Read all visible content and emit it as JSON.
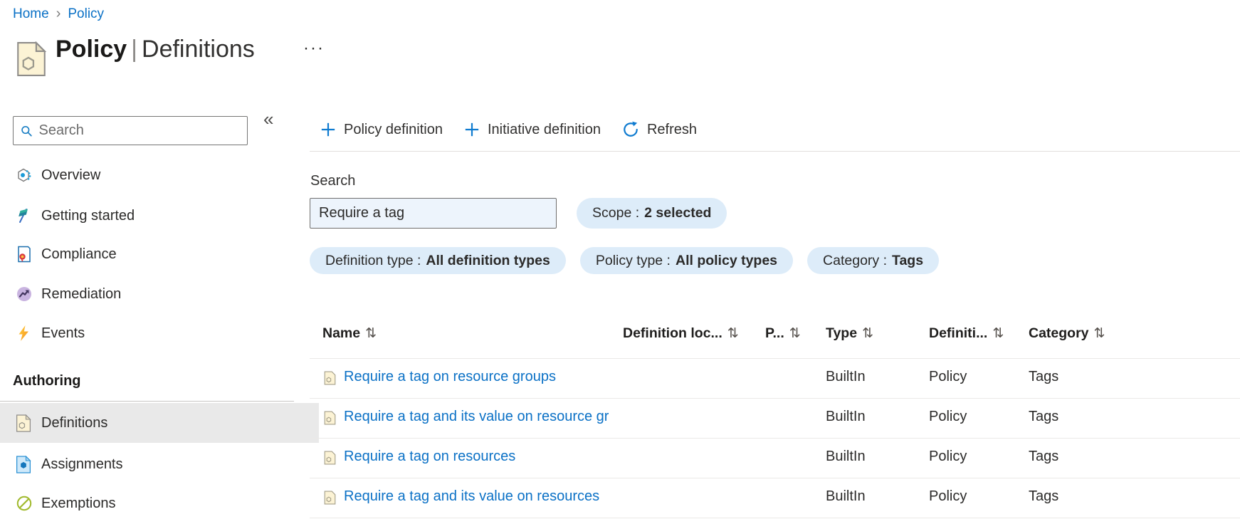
{
  "breadcrumb": {
    "separator": "›",
    "items": [
      {
        "label": "Home"
      },
      {
        "label": "Policy"
      }
    ]
  },
  "header": {
    "title_primary": "Policy",
    "title_separator": "|",
    "title_secondary": "Definitions",
    "more_glyph": "···"
  },
  "sidebar": {
    "search_placeholder": "Search",
    "collapse_glyph": "«",
    "items": [
      {
        "label": "Overview",
        "icon": "overview-icon"
      },
      {
        "label": "Getting started",
        "icon": "getting-started-icon"
      },
      {
        "label": "Compliance",
        "icon": "compliance-icon"
      },
      {
        "label": "Remediation",
        "icon": "remediation-icon"
      },
      {
        "label": "Events",
        "icon": "events-icon"
      }
    ],
    "section_label": "Authoring",
    "section_items": [
      {
        "label": "Definitions",
        "icon": "definitions-icon",
        "selected": true
      },
      {
        "label": "Assignments",
        "icon": "assignments-icon",
        "selected": false
      },
      {
        "label": "Exemptions",
        "icon": "exemptions-icon",
        "selected": false
      }
    ]
  },
  "toolbar": {
    "actions": [
      {
        "label": "Policy definition",
        "icon": "plus-icon"
      },
      {
        "label": "Initiative definition",
        "icon": "plus-icon"
      },
      {
        "label": "Refresh",
        "icon": "refresh-icon"
      }
    ]
  },
  "filters": {
    "search_label": "Search",
    "search_value": "Require a tag",
    "scope": {
      "label": "Scope :",
      "value": "2 selected"
    },
    "pills": [
      {
        "label": "Definition type :",
        "value": "All definition types"
      },
      {
        "label": "Policy type :",
        "value": "All policy types"
      },
      {
        "label": "Category :",
        "value": "Tags"
      }
    ]
  },
  "table": {
    "sort_glyph": "⇅",
    "columns": [
      {
        "label": "Name"
      },
      {
        "label": "Definition loc..."
      },
      {
        "label": "P..."
      },
      {
        "label": "Type"
      },
      {
        "label": "Definiti..."
      },
      {
        "label": "Category"
      }
    ],
    "rows": [
      {
        "name": "Require a tag on resource groups",
        "definition_location": "",
        "policies": "",
        "type": "BuiltIn",
        "definition_type": "Policy",
        "category": "Tags"
      },
      {
        "name": "Require a tag and its value on resource gr",
        "definition_location": "",
        "policies": "",
        "type": "BuiltIn",
        "definition_type": "Policy",
        "category": "Tags"
      },
      {
        "name": "Require a tag on resources",
        "definition_location": "",
        "policies": "",
        "type": "BuiltIn",
        "definition_type": "Policy",
        "category": "Tags"
      },
      {
        "name": "Require a tag and its value on resources",
        "definition_location": "",
        "policies": "",
        "type": "BuiltIn",
        "definition_type": "Policy",
        "category": "Tags"
      }
    ]
  },
  "colors": {
    "accent": "#0078d4",
    "link": "#0b71c6",
    "pill_bg": "#ddecf9",
    "selected_item_bg": "#e9e9e9",
    "text": "#252423"
  }
}
